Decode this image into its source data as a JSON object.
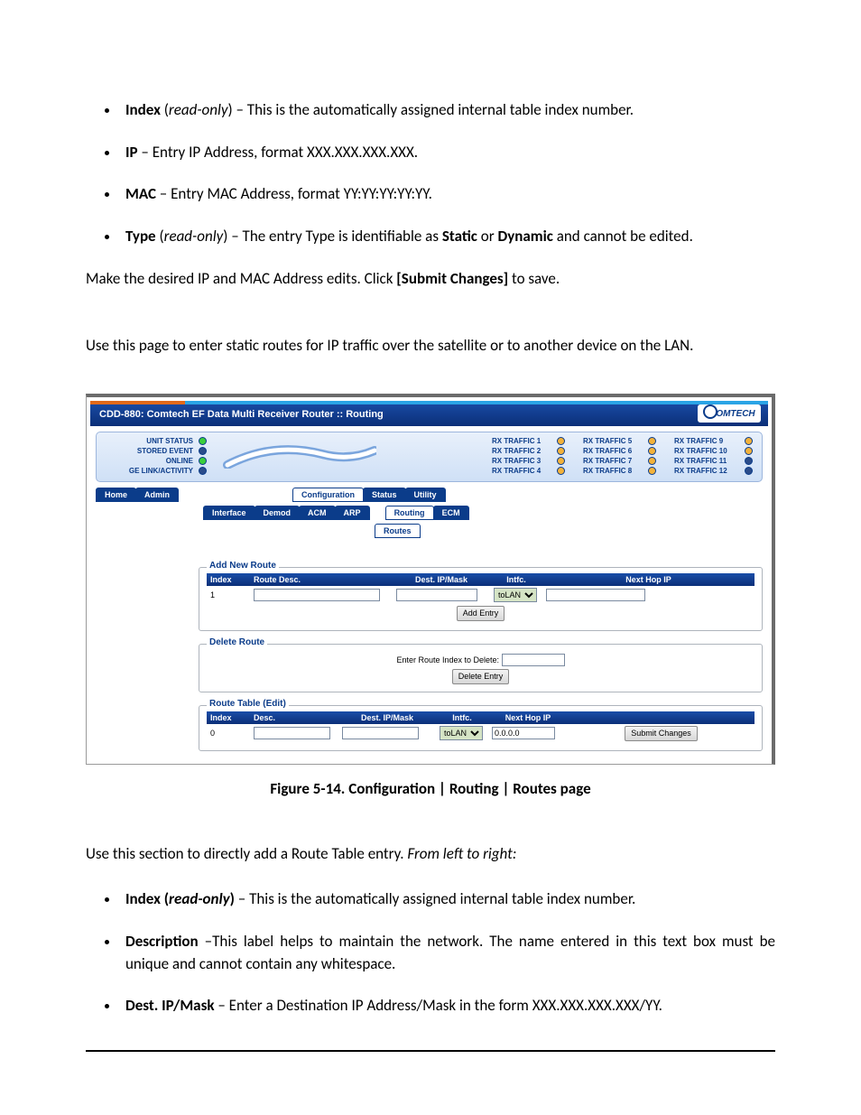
{
  "bullets_top": [
    {
      "term": "Index",
      "paren": "read-only",
      "tail": " – This is the automatically assigned internal table index number."
    },
    {
      "term": "IP",
      "paren": "",
      "tail": " – Entry IP Address, format XXX.XXX.XXX.XXX."
    },
    {
      "term": "MAC",
      "paren": "",
      "tail": " – Entry MAC Address, format YY:YY:YY:YY:YY."
    },
    {
      "term": "Type",
      "paren": "read-only",
      "tail_pre": " – The entry Type is identifiable as ",
      "bold1": "Static",
      "mid": " or ",
      "bold2": "Dynamic",
      "tail_post": " and cannot be edited."
    }
  ],
  "para1_pre": "Make the desired IP and MAC Address edits. Click ",
  "para1_bold": "[Submit Changes]",
  "para1_post": " to save.",
  "para2": "Use this page to enter static routes for IP traffic over the satellite or to another device on the LAN.",
  "shot": {
    "title": "CDD-880: Comtech EF Data Multi Receiver Router :: Routing",
    "logo": "OMTECH",
    "status_left": [
      "UNIT STATUS",
      "STORED EVENT",
      "ONLINE",
      "GE LINK/ACTIVITY"
    ],
    "status_led": [
      "g",
      "d",
      "g",
      "d"
    ],
    "rx": [
      [
        "RX TRAFFIC 1",
        "RX TRAFFIC 2",
        "RX TRAFFIC 3",
        "RX TRAFFIC 4"
      ],
      [
        "RX TRAFFIC 5",
        "RX TRAFFIC 6",
        "RX TRAFFIC 7",
        "RX TRAFFIC 8"
      ],
      [
        "RX TRAFFIC 9",
        "RX TRAFFIC 10",
        "RX TRAFFIC 11",
        "RX TRAFFIC 12"
      ]
    ],
    "rx_led": [
      [
        "a",
        "a",
        "a",
        "a"
      ],
      [
        "a",
        "a",
        "a",
        "a"
      ],
      [
        "a",
        "a",
        "d",
        "d"
      ]
    ],
    "tabs1": [
      "Home",
      "Admin"
    ],
    "tabs1b": [
      "Configuration",
      "Status",
      "Utility"
    ],
    "tabs2": [
      "Interface",
      "Demod",
      "ACM",
      "ARP"
    ],
    "tabs2b": [
      "Routing",
      "ECM"
    ],
    "tabs3": [
      "Routes"
    ],
    "add": {
      "legend": "Add New Route",
      "hdr": [
        "Index",
        "Route Desc.",
        "Dest. IP/Mask",
        "Intfc.",
        "Next Hop IP"
      ],
      "index": "1",
      "intfc": "toLAN",
      "btn": "Add Entry"
    },
    "del": {
      "legend": "Delete Route",
      "label": "Enter Route Index to Delete:",
      "btn": "Delete Entry"
    },
    "edit": {
      "legend": "Route Table (Edit)",
      "hdr": [
        "Index",
        "Desc.",
        "Dest. IP/Mask",
        "Intfc.",
        "Next Hop IP"
      ],
      "index": "0",
      "intfc": "toLAN",
      "nexthop": "0.0.0.0",
      "btn": "Submit Changes"
    }
  },
  "caption": "Figure 5-14. Configuration | Routing | Routes page",
  "para3_pre": "Use this section to directly add a Route Table entry. ",
  "para3_ital": "From left to right:",
  "bullets_bot": [
    {
      "term": "Index (",
      "paren": "read-only",
      "term2": ")",
      "tail": " – This is the automatically assigned internal table index number."
    },
    {
      "term": "Description",
      "tail": " –This label helps to maintain the network. The name entered in this text box must be unique and cannot contain any whitespace."
    },
    {
      "term": "Dest. IP/Mask",
      "tail": " – Enter a Destination IP Address/Mask in the form XXX.XXX.XXX.XXX/YY."
    }
  ]
}
